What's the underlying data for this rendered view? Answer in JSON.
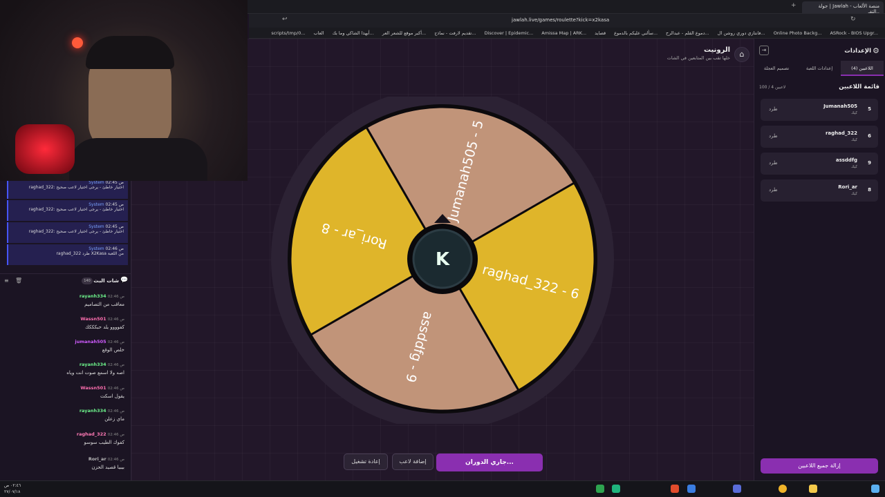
{
  "browser": {
    "url": "jawlah.live/games/roulette?kick=x2kasa",
    "tab_title": "جولة | Jawlah - منصة الألعاب التفـ..",
    "bookmarks": [
      "ASRock - BIOS Upgr...",
      "Online Photo Backg...",
      "فانتازي دوري روشن ال...",
      "دموع القلم - عبدالرح...",
      "سألني عليكم بالدموع...",
      "قصايد",
      "Amissa Map | ARK...",
      "Discover | Epidemic...",
      "تقديم لارفت - نماذج...",
      "أكبر موقع للشعر العر...",
      "أبهذا الشاكي وما بك...",
      "العاب",
      "scripts/tmp/0..."
    ]
  },
  "header": {
    "title": "الرونيت",
    "subtitle": "خلها تقب بين المتابعين في الشات"
  },
  "wheel": {
    "segments": [
      {
        "label": "Jumanah505 - 5",
        "color": "#c19479"
      },
      {
        "label": "raghad_322 - 6",
        "color": "#dfb52a"
      },
      {
        "label": "assddfg - 9",
        "color": "#c19479"
      },
      {
        "label": "Rori_ar - 8",
        "color": "#dfb52a"
      }
    ],
    "center_logo": "K"
  },
  "controls": {
    "spin_label": "جاري الدوران...",
    "add_player_label": "إضافة لاعب",
    "restart_label": "إعادة تشغيل"
  },
  "settings": {
    "title": "الإعدادات",
    "tabs": [
      "اللاعبين (4)",
      "إعدادات اللعبة",
      "تصميم العجلة"
    ],
    "list_title": "قائمة اللاعبين",
    "count": "100 / 4 لاعبين",
    "players": [
      {
        "name": "Jumanah505",
        "num": "5",
        "status": "كيك",
        "kick": "طرد"
      },
      {
        "name": "raghad_322",
        "num": "6",
        "status": "كيك",
        "kick": "طرد"
      },
      {
        "name": "assddfg",
        "num": "9",
        "status": "كيك",
        "kick": "طرد"
      },
      {
        "name": "Rori_ar",
        "num": "8",
        "status": "كيك",
        "kick": "طرد"
      }
    ],
    "remove_all_label": "إزالة جميع اللاعبين"
  },
  "system_messages": [
    {
      "time": "02:45 ص",
      "sender": "System",
      "text": "raghad_322: اختيار خاطئ - يرجى اختيار لاعب صحيح"
    },
    {
      "time": "02:45 ص",
      "sender": "System",
      "text": "raghad_322: اختيار خاطئ - يرجى اختيار لاعب صحيح"
    },
    {
      "time": "02:45 ص",
      "sender": "System",
      "text": "raghad_322: اختيار خاطئ - يرجى اختيار لاعب صحيح"
    },
    {
      "time": "02:46 ص",
      "sender": "System",
      "text": "raghad_322 طرد X2Kasa من اللعبة"
    }
  ],
  "chat": {
    "title": "شات البث",
    "count": "140",
    "messages": [
      {
        "user": "rayanh334",
        "time": "02:46 ص",
        "text": "معاقب من التصاميم",
        "color": "#6cf08a"
      },
      {
        "user": "Wassn501",
        "time": "02:46 ص",
        "text": "كفوووو يلد حبكككك",
        "color": "#ff6fb0"
      },
      {
        "user": "jumanah505",
        "time": "02:46 ص",
        "text": "خلص الوقع",
        "color": "#d05cff"
      },
      {
        "user": "rayanh334",
        "time": "02:46 ص",
        "text": "اصه ولا اسمع صوت انت وياه",
        "color": "#6cf08a"
      },
      {
        "user": "Wassn501",
        "time": "02:46 ص",
        "text": "يقول اسكت",
        "color": "#ff6fb0"
      },
      {
        "user": "rayanh334",
        "time": "02:46 ص",
        "text": "ماي زعلن",
        "color": "#6cf08a"
      },
      {
        "user": "raghad_322",
        "time": "02:46 ص",
        "text": "كفوك الطيب سوسو",
        "color": "#ff7ab5"
      },
      {
        "user": "Rori_ar",
        "time": "02:46 ص",
        "text": "بيبيا قصيد الحزن",
        "color": "#bbbbbb"
      }
    ]
  },
  "taskbar": {
    "time": "٠٢:٤٦ ص",
    "date": "٢٧/٠٧/١٨"
  }
}
